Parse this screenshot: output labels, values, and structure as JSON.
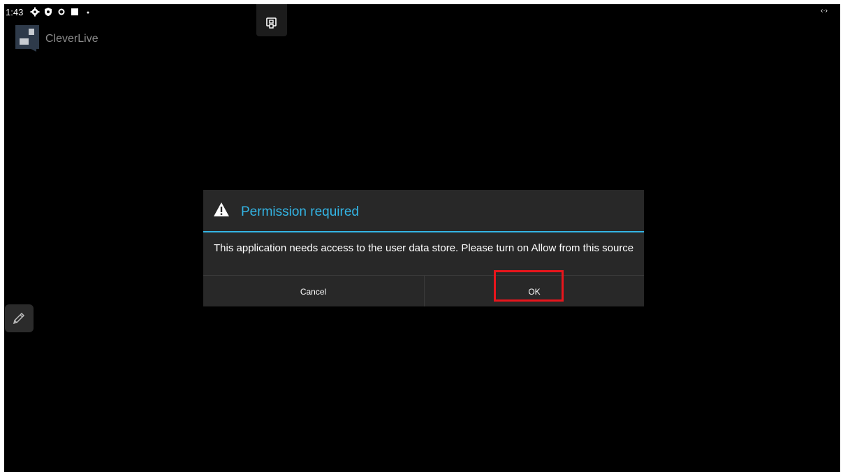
{
  "status_bar": {
    "time": "1:43",
    "icons": [
      "gear-icon",
      "shield-icon",
      "circle-icon",
      "square-icon",
      "dot-icon"
    ],
    "right_icon": "code-arrows-icon",
    "right_symbol": "‹·›"
  },
  "app": {
    "name": "CleverLive",
    "logo_icon": "clever-logo-icon"
  },
  "top_button": {
    "icon": "screen-record-icon"
  },
  "side_button": {
    "icon": "pencil-icon"
  },
  "dialog": {
    "title": "Permission required",
    "icon": "warning-icon",
    "message": "This application needs access to the user data store. Please turn on Allow from this source",
    "buttons": {
      "cancel_label": "Cancel",
      "ok_label": "OK"
    }
  },
  "colors": {
    "accent": "#33b5e5",
    "highlight": "#e8151c",
    "dialog_bg": "#282828",
    "screen_bg": "#000000"
  }
}
